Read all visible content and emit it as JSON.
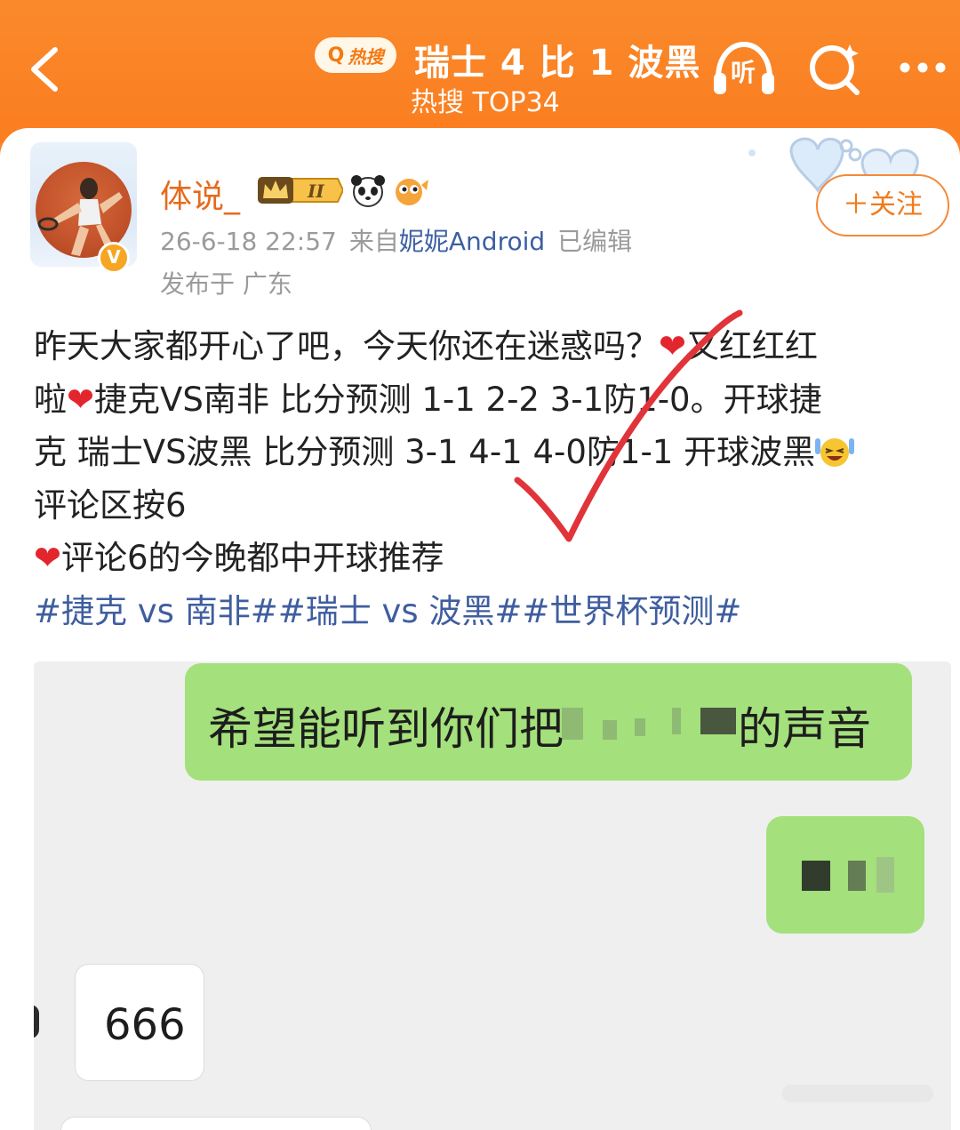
{
  "header": {
    "back_icon": "chevron-left-icon",
    "hot_badge_label": "热搜",
    "title": "瑞士 4 比 1 波黑",
    "subtitle": "热搜 TOP34",
    "listen_label": "听",
    "search_icon": "search-sparkle-icon",
    "more_icon": "more-dots-icon"
  },
  "post": {
    "author": {
      "name": "体说_",
      "level_badge": "II",
      "verified_badge": "V"
    },
    "timestamp": "26-6-18 22:57",
    "source_prefix": "来自",
    "source_link": "妮妮Android",
    "edited_label": "已编辑",
    "location": "发布于 广东",
    "follow_label": "＋关注",
    "body_lines": [
      "昨天大家都开心了吧，今天你还在迷惑吗？",
      "又红红红",
      "啦",
      "捷克VS南非 比分预测 1-1  2-2 3-1防1-0。开球捷",
      "克 瑞士VS波黑 比分预测 3-1 4-1 4-0防1-1 开球波黑",
      "评论区按6",
      "评论6的今晚都中开球推荐"
    ],
    "heart_emoji": "❤",
    "hashtags": "#捷克 vs 南非##瑞士 vs 波黑##世界杯预测#"
  },
  "chat_image": {
    "message_1_prefix": "希望能听到你们把",
    "message_1_suffix": "的声音",
    "message_3": "666"
  },
  "colors": {
    "header_orange": "#fb8426",
    "accent_orange": "#f07a1c",
    "link_blue": "#3f5e9f",
    "heart_red": "#e3262e",
    "check_red": "#e0343a",
    "bubble_green": "#a4e07c"
  }
}
